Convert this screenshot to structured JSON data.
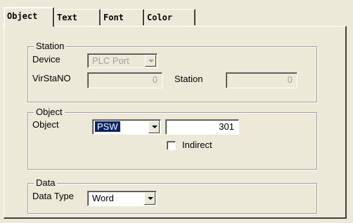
{
  "tabs": [
    {
      "label": "Object",
      "active": true
    },
    {
      "label": "Text",
      "active": false
    },
    {
      "label": "Font",
      "active": false
    },
    {
      "label": "Color",
      "active": false
    }
  ],
  "station": {
    "legend": "Station",
    "device_label": "Device",
    "device_value": "PLC Port",
    "virstano_label": "VirStaNO",
    "virstano_value": "0",
    "station_label": "Station",
    "station_value": "0"
  },
  "object": {
    "legend": "Object",
    "object_label": "Object",
    "object_type": "PSW",
    "address": "301",
    "indirect_label": "Indirect",
    "indirect_checked": false
  },
  "data": {
    "legend": "Data",
    "data_type_label": "Data Type",
    "data_type_value": "Word"
  }
}
